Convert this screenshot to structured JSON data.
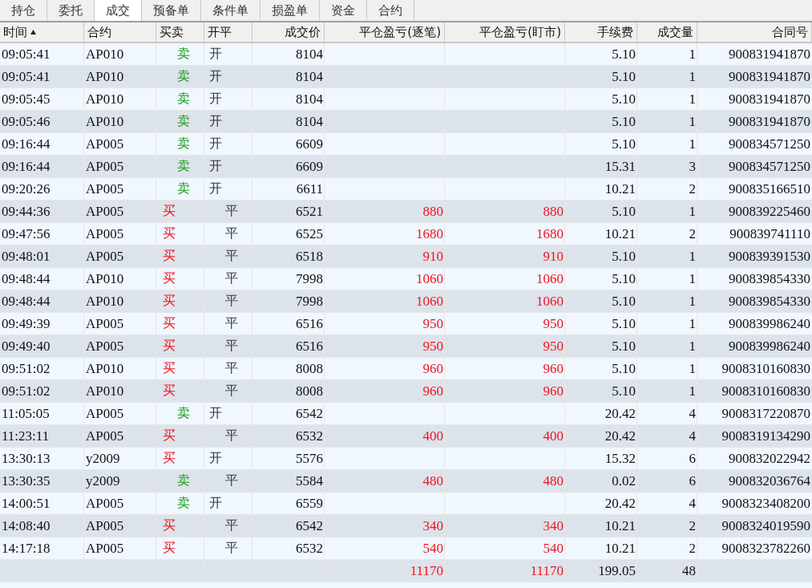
{
  "tabs": [
    {
      "label": "持仓",
      "selected": false
    },
    {
      "label": "委托",
      "selected": false
    },
    {
      "label": "成交",
      "selected": true
    },
    {
      "label": "预备单",
      "selected": false
    },
    {
      "label": "条件单",
      "selected": false
    },
    {
      "label": "损盈单",
      "selected": false
    },
    {
      "label": "资金",
      "selected": false
    },
    {
      "label": "合约",
      "selected": false
    }
  ],
  "table": {
    "columns": [
      {
        "label": "时间",
        "sorted": true
      },
      {
        "label": "合约",
        "sorted": false
      },
      {
        "label": "买卖",
        "sorted": false
      },
      {
        "label": "开平",
        "sorted": false
      },
      {
        "label": "成交价",
        "sorted": false
      },
      {
        "label": "平仓盈亏(逐笔)",
        "sorted": false
      },
      {
        "label": "平仓盈亏(盯市)",
        "sorted": false
      },
      {
        "label": "手续费",
        "sorted": false
      },
      {
        "label": "成交量",
        "sorted": false
      },
      {
        "label": "合同号",
        "sorted": false
      }
    ],
    "rows": [
      {
        "time": "09:05:41",
        "contract": "AP010",
        "side": {
          "text": "卖",
          "kind": "sell"
        },
        "offset": {
          "text": "开",
          "kind": "open"
        },
        "price": "8104",
        "fee": "5.10",
        "qty": "1",
        "order_no": "900831941870"
      },
      {
        "time": "09:05:41",
        "contract": "AP010",
        "side": {
          "text": "卖",
          "kind": "sell"
        },
        "offset": {
          "text": "开",
          "kind": "open"
        },
        "price": "8104",
        "fee": "5.10",
        "qty": "1",
        "order_no": "900831941870"
      },
      {
        "time": "09:05:45",
        "contract": "AP010",
        "side": {
          "text": "卖",
          "kind": "sell"
        },
        "offset": {
          "text": "开",
          "kind": "open"
        },
        "price": "8104",
        "fee": "5.10",
        "qty": "1",
        "order_no": "900831941870"
      },
      {
        "time": "09:05:46",
        "contract": "AP010",
        "side": {
          "text": "卖",
          "kind": "sell"
        },
        "offset": {
          "text": "开",
          "kind": "open"
        },
        "price": "8104",
        "fee": "5.10",
        "qty": "1",
        "order_no": "900831941870"
      },
      {
        "time": "09:16:44",
        "contract": "AP005",
        "side": {
          "text": "卖",
          "kind": "sell"
        },
        "offset": {
          "text": "开",
          "kind": "open"
        },
        "price": "6609",
        "fee": "5.10",
        "qty": "1",
        "order_no": "900834571250"
      },
      {
        "time": "09:16:44",
        "contract": "AP005",
        "side": {
          "text": "卖",
          "kind": "sell"
        },
        "offset": {
          "text": "开",
          "kind": "open"
        },
        "price": "6609",
        "fee": "15.31",
        "qty": "3",
        "order_no": "900834571250"
      },
      {
        "time": "09:20:26",
        "contract": "AP005",
        "side": {
          "text": "卖",
          "kind": "sell"
        },
        "offset": {
          "text": "开",
          "kind": "open"
        },
        "price": "6611",
        "fee": "10.21",
        "qty": "2",
        "order_no": "900835166510"
      },
      {
        "time": "09:44:36",
        "contract": "AP005",
        "side": {
          "text": "买",
          "kind": "buy"
        },
        "offset": {
          "text": "平",
          "kind": "close"
        },
        "price": "6521",
        "pnl_trade": "880",
        "pnl_mark": "880",
        "fee": "5.10",
        "qty": "1",
        "order_no": "900839225460"
      },
      {
        "time": "09:47:56",
        "contract": "AP005",
        "side": {
          "text": "买",
          "kind": "buy"
        },
        "offset": {
          "text": "平",
          "kind": "close"
        },
        "price": "6525",
        "pnl_trade": "1680",
        "pnl_mark": "1680",
        "fee": "10.21",
        "qty": "2",
        "order_no": "900839741110"
      },
      {
        "time": "09:48:01",
        "contract": "AP005",
        "side": {
          "text": "买",
          "kind": "buy"
        },
        "offset": {
          "text": "平",
          "kind": "close"
        },
        "price": "6518",
        "pnl_trade": "910",
        "pnl_mark": "910",
        "fee": "5.10",
        "qty": "1",
        "order_no": "900839391530"
      },
      {
        "time": "09:48:44",
        "contract": "AP010",
        "side": {
          "text": "买",
          "kind": "buy"
        },
        "offset": {
          "text": "平",
          "kind": "close"
        },
        "price": "7998",
        "pnl_trade": "1060",
        "pnl_mark": "1060",
        "fee": "5.10",
        "qty": "1",
        "order_no": "900839854330"
      },
      {
        "time": "09:48:44",
        "contract": "AP010",
        "side": {
          "text": "买",
          "kind": "buy"
        },
        "offset": {
          "text": "平",
          "kind": "close"
        },
        "price": "7998",
        "pnl_trade": "1060",
        "pnl_mark": "1060",
        "fee": "5.10",
        "qty": "1",
        "order_no": "900839854330"
      },
      {
        "time": "09:49:39",
        "contract": "AP005",
        "side": {
          "text": "买",
          "kind": "buy"
        },
        "offset": {
          "text": "平",
          "kind": "close"
        },
        "price": "6516",
        "pnl_trade": "950",
        "pnl_mark": "950",
        "fee": "5.10",
        "qty": "1",
        "order_no": "900839986240"
      },
      {
        "time": "09:49:40",
        "contract": "AP005",
        "side": {
          "text": "买",
          "kind": "buy"
        },
        "offset": {
          "text": "平",
          "kind": "close"
        },
        "price": "6516",
        "pnl_trade": "950",
        "pnl_mark": "950",
        "fee": "5.10",
        "qty": "1",
        "order_no": "900839986240"
      },
      {
        "time": "09:51:02",
        "contract": "AP010",
        "side": {
          "text": "买",
          "kind": "buy"
        },
        "offset": {
          "text": "平",
          "kind": "close"
        },
        "price": "8008",
        "pnl_trade": "960",
        "pnl_mark": "960",
        "fee": "5.10",
        "qty": "1",
        "order_no": "9008310160830"
      },
      {
        "time": "09:51:02",
        "contract": "AP010",
        "side": {
          "text": "买",
          "kind": "buy"
        },
        "offset": {
          "text": "平",
          "kind": "close"
        },
        "price": "8008",
        "pnl_trade": "960",
        "pnl_mark": "960",
        "fee": "5.10",
        "qty": "1",
        "order_no": "9008310160830"
      },
      {
        "time": "11:05:05",
        "contract": "AP005",
        "side": {
          "text": "卖",
          "kind": "sell"
        },
        "offset": {
          "text": "开",
          "kind": "open"
        },
        "price": "6542",
        "fee": "20.42",
        "qty": "4",
        "order_no": "9008317220870"
      },
      {
        "time": "11:23:11",
        "contract": "AP005",
        "side": {
          "text": "买",
          "kind": "buy"
        },
        "offset": {
          "text": "平",
          "kind": "close"
        },
        "price": "6532",
        "pnl_trade": "400",
        "pnl_mark": "400",
        "fee": "20.42",
        "qty": "4",
        "order_no": "9008319134290"
      },
      {
        "time": "13:30:13",
        "contract": "y2009",
        "side": {
          "text": "买",
          "kind": "buy"
        },
        "offset": {
          "text": "开",
          "kind": "open"
        },
        "price": "5576",
        "fee": "15.32",
        "qty": "6",
        "order_no": "900832022942"
      },
      {
        "time": "13:30:35",
        "contract": "y2009",
        "side": {
          "text": "卖",
          "kind": "sell"
        },
        "offset": {
          "text": "平",
          "kind": "close"
        },
        "price": "5584",
        "pnl_trade": "480",
        "pnl_mark": "480",
        "fee": "0.02",
        "qty": "6",
        "order_no": "900832036764"
      },
      {
        "time": "14:00:51",
        "contract": "AP005",
        "side": {
          "text": "卖",
          "kind": "sell"
        },
        "offset": {
          "text": "开",
          "kind": "open"
        },
        "price": "6559",
        "fee": "20.42",
        "qty": "4",
        "order_no": "9008323408200"
      },
      {
        "time": "14:08:40",
        "contract": "AP005",
        "side": {
          "text": "买",
          "kind": "buy"
        },
        "offset": {
          "text": "平",
          "kind": "close"
        },
        "price": "6542",
        "pnl_trade": "340",
        "pnl_mark": "340",
        "fee": "10.21",
        "qty": "2",
        "order_no": "9008324019590"
      },
      {
        "time": "14:17:18",
        "contract": "AP005",
        "side": {
          "text": "买",
          "kind": "buy"
        },
        "offset": {
          "text": "平",
          "kind": "close"
        },
        "price": "6532",
        "pnl_trade": "540",
        "pnl_mark": "540",
        "fee": "10.21",
        "qty": "2",
        "order_no": "9008323782260"
      }
    ],
    "total": {
      "pnl_trade": "11170",
      "pnl_mark": "11170",
      "fee": "199.05",
      "qty": "48"
    }
  }
}
